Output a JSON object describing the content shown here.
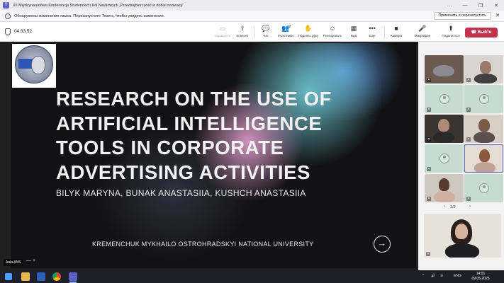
{
  "window": {
    "title": "XII Międzynarodowa Konferencja Studenckich Kół Naukowych „Przedsiębiorczość w dobie innowacji”",
    "controls": [
      "…",
      "—",
      "❐",
      "✕"
    ]
  },
  "notice": {
    "text": "Обнаружены изменения языка. Перезапустите Teams, чтобы увидеть изменение.",
    "button": "Применить и перезапустить",
    "close": "✕"
  },
  "toolbar": {
    "timer": "04:33:52",
    "tools": [
      {
        "label": "Управлять",
        "icon": "▭",
        "name": "manage"
      },
      {
        "label": "Контент",
        "icon": "⇪",
        "name": "content"
      },
      {
        "label": "Чат",
        "icon": "💬",
        "name": "chat"
      },
      {
        "label": "Участники",
        "icon": "👥",
        "name": "participants",
        "count": "12"
      },
      {
        "label": "Поднять руку",
        "icon": "✋",
        "name": "raise-hand"
      },
      {
        "label": "Реагировать",
        "icon": "☺",
        "name": "react"
      },
      {
        "label": "Вид",
        "icon": "▦",
        "name": "view"
      },
      {
        "label": "Еще",
        "icon": "•••",
        "name": "more"
      },
      {
        "label": "Камера",
        "icon": "■",
        "name": "camera"
      },
      {
        "label": "Микрофон",
        "icon": "🎤",
        "name": "microphone"
      },
      {
        "label": "Поделиться",
        "icon": "⬆",
        "name": "share"
      }
    ],
    "leave_label": "Выйти"
  },
  "slide": {
    "title": "RESEARCH ON THE USE OF ARTIFICIAL INTELLIGENCE TOOLS IN CORPORATE ADVERTISING ACTIVITIES",
    "authors": "BILYK MARYNA, BUNAK ANASTASIIA, KUSHCH ANASTASIIA",
    "university": "KREMENCHUK MYKHAILO OSTROHRADSKYI NATIONAL UNIVERSITY",
    "next": "→"
  },
  "presenter": {
    "name": "Aula ANS",
    "controls": "—  +"
  },
  "gallery": {
    "page": "1/2",
    "prev": "‹",
    "next": "›"
  },
  "taskbar": {
    "tray_lang": "ENG",
    "time": "14:01",
    "date": "09.05.2025"
  }
}
